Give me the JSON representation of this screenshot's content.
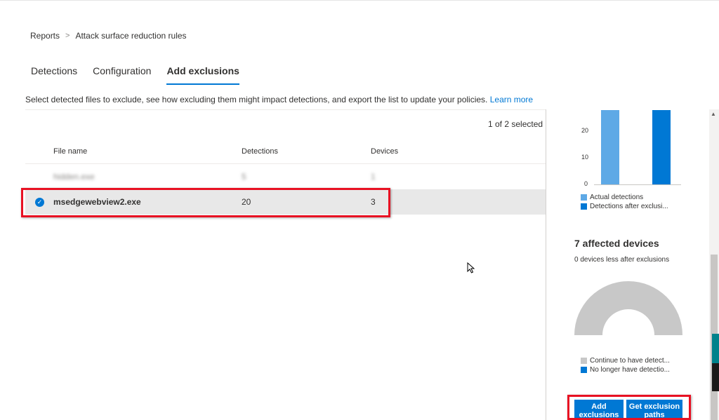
{
  "breadcrumb": {
    "root": "Reports",
    "separator": ">",
    "current": "Attack surface reduction rules"
  },
  "tabs": [
    {
      "label": "Detections",
      "active": false
    },
    {
      "label": "Configuration",
      "active": false
    },
    {
      "label": "Add exclusions",
      "active": true
    }
  ],
  "description": {
    "text": "Select detected files to exclude, see how excluding them might impact detections, and export the list to update your policies.",
    "link": "Learn more"
  },
  "table": {
    "selected_count": "1 of 2 selected",
    "columns": [
      "File name",
      "Detections",
      "Devices"
    ],
    "rows": [
      {
        "file": "hidden.exe",
        "detections": "5",
        "devices": "1",
        "selected": false,
        "obscured": true
      },
      {
        "file": "msedgewebview2.exe",
        "detections": "20",
        "devices": "3",
        "selected": true,
        "obscured": false
      }
    ]
  },
  "detections_chart": {
    "y_ticks": [
      "20",
      "10",
      "0"
    ],
    "legend": [
      {
        "label": "Actual detections",
        "color": "#5ea9e6"
      },
      {
        "label": "Detections after exclusi...",
        "color": "#0078d4"
      }
    ]
  },
  "devices": {
    "title": "7 affected devices",
    "subtitle": "0 devices less after exclusions",
    "legend": [
      {
        "label": "Continue to have detect...",
        "color": "#c8c8c8"
      },
      {
        "label": "No longer have detectio...",
        "color": "#0078d4"
      }
    ]
  },
  "actions": {
    "add_exclusions": "Add exclusions",
    "get_exclusion_paths": "Get exclusion paths"
  },
  "colors": {
    "accent": "#0078d4",
    "highlight_box": "#e81123"
  },
  "icons": {
    "check": "check-circle-icon",
    "chevron": "chevron-right-icon"
  }
}
